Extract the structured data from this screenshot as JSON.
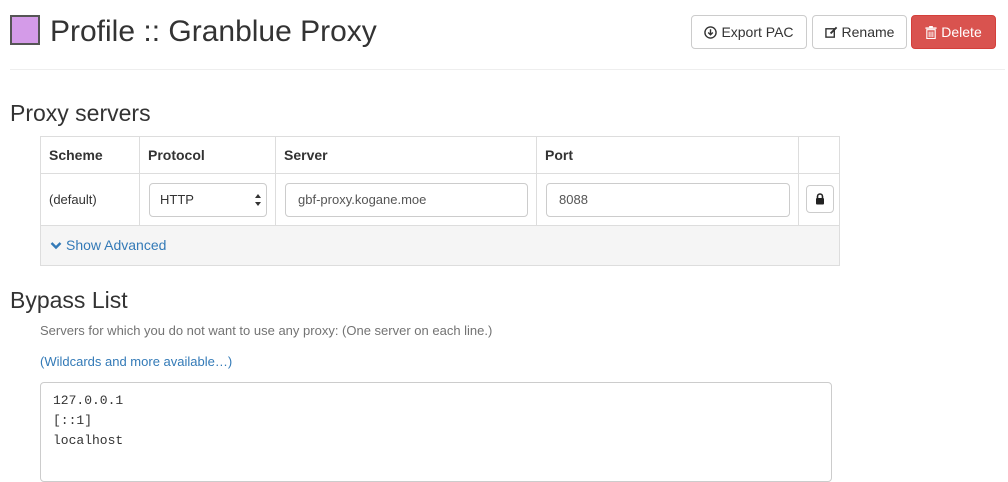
{
  "header": {
    "title": "Profile :: Granblue Proxy",
    "profile_color": "#d49be8",
    "buttons": {
      "export_label": "Export PAC",
      "rename_label": "Rename",
      "delete_label": "Delete"
    }
  },
  "proxy_servers": {
    "heading": "Proxy servers",
    "columns": [
      "Scheme",
      "Protocol",
      "Server",
      "Port"
    ],
    "row": {
      "scheme": "(default)",
      "protocol": "HTTP",
      "server": "gbf-proxy.kogane.moe",
      "port": "8088"
    },
    "show_advanced_label": "Show Advanced"
  },
  "bypass": {
    "heading": "Bypass List",
    "help_text": "Servers for which you do not want to use any proxy: (One server on each line.)",
    "wildcards_link": "(Wildcards and more available…)",
    "lines": [
      "127.0.0.1",
      "[::1]",
      "localhost"
    ]
  },
  "colors": {
    "link": "#337ab7",
    "danger": "#d9534f"
  }
}
